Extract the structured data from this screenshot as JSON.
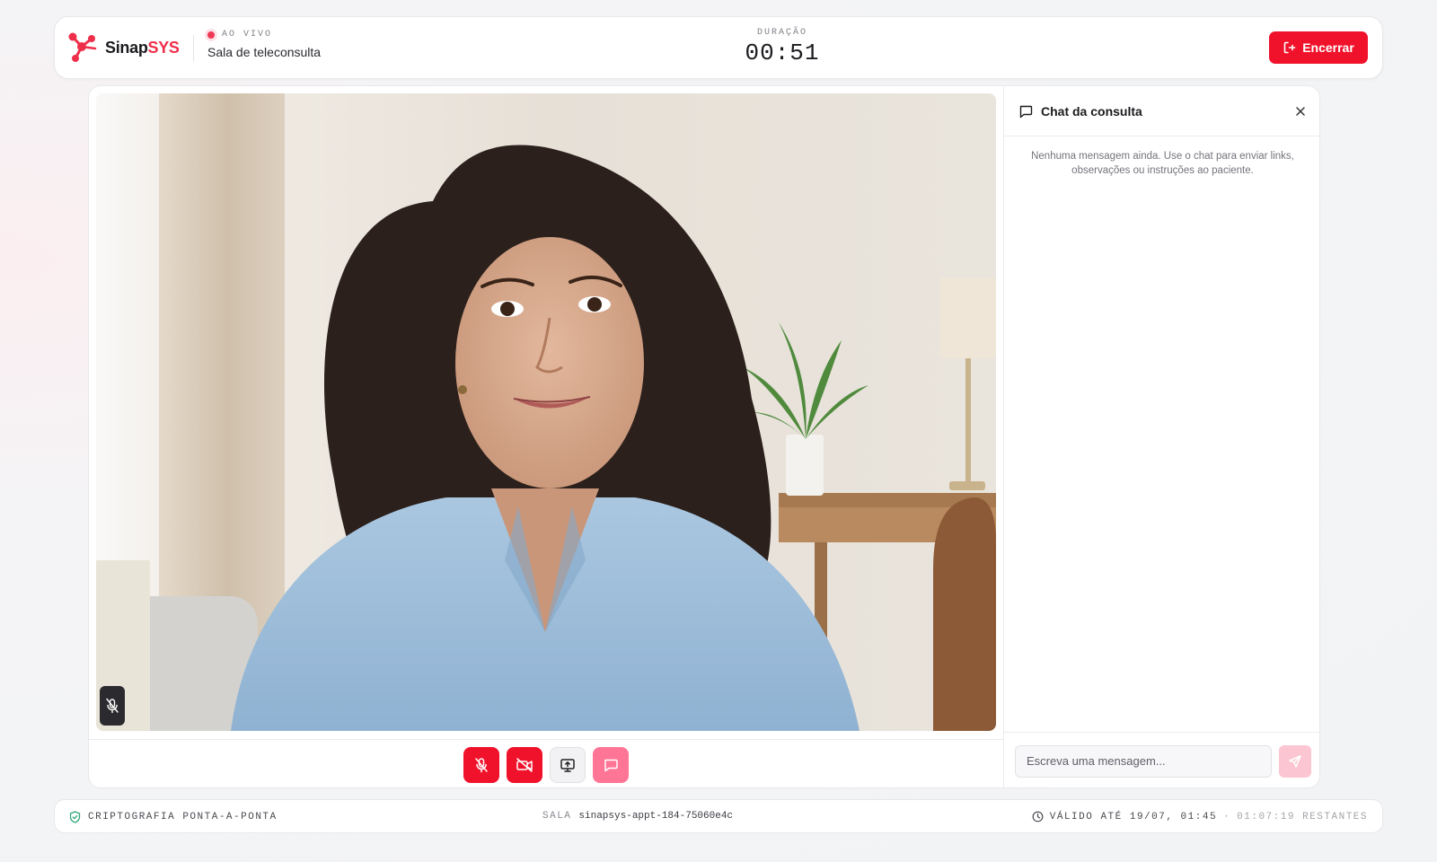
{
  "header": {
    "brand_primary": "Sinap",
    "brand_accent": "SYS",
    "live_label": "AO VIVO",
    "room_title": "Sala de teleconsulta",
    "duration_label": "DURAÇÃO",
    "duration_value": "00:51",
    "end_label": "Encerrar"
  },
  "controls": {
    "mic": {
      "state": "muted",
      "icon": "mic-off-icon"
    },
    "camera": {
      "state": "off",
      "icon": "video-off-icon"
    },
    "screen_share": {
      "icon": "screen-share-icon"
    },
    "chat": {
      "state": "active",
      "icon": "chat-icon"
    }
  },
  "chat": {
    "title": "Chat da consulta",
    "empty_text": "Nenhuma mensagem ainda. Use o chat para enviar links, observações ou instruções ao paciente.",
    "input_placeholder": "Escreva uma mensagem..."
  },
  "footer": {
    "encryption_label": "CRIPTOGRAFIA PONTA-A-PONTA",
    "room_label": "SALA",
    "room_id": "sinapsys-appt-184-75060e4c",
    "valid_label": "VÁLIDO ATÉ 19/07, 01:45",
    "separator": "·",
    "remaining": "01:07:19 RESTANTES"
  },
  "colors": {
    "accent": "#f0122b",
    "brand_accent": "#ef2f4a",
    "live": "#f03a55",
    "chat_active": "#ff7596"
  }
}
